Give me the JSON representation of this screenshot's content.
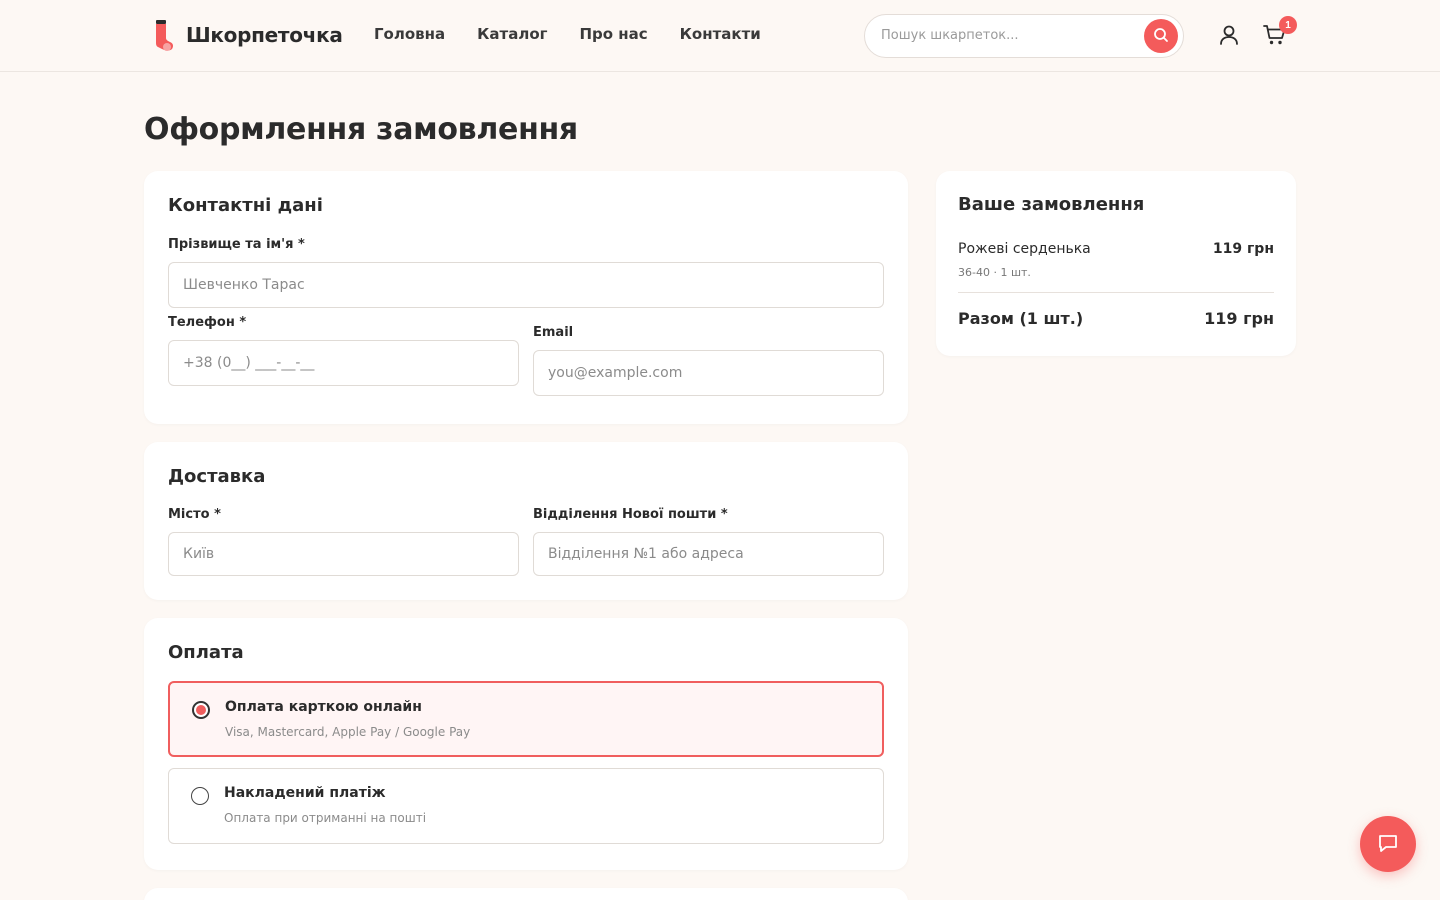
{
  "brand": {
    "name": "Шкорпеточка",
    "accent": "#f45b5b"
  },
  "nav": [
    "Головна",
    "Каталог",
    "Про нас",
    "Контакти"
  ],
  "search": {
    "placeholder": "Пошук шкарпеток..."
  },
  "cart": {
    "count": "1"
  },
  "page": {
    "title": "Оформлення замовлення"
  },
  "contact": {
    "title": "Контактні дані",
    "name_label": "Прізвище та ім'я *",
    "name_placeholder": "Шевченко Тарас",
    "phone_label": "Телефон *",
    "phone_placeholder": "+38 (0__) ___-__-__",
    "email_label": "Email",
    "email_placeholder": "you@example.com"
  },
  "delivery": {
    "title": "Доставка",
    "city_label": "Місто *",
    "city_placeholder": "Київ",
    "branch_label": "Відділення Нової пошти *",
    "branch_placeholder": "Відділення №1 або адреса"
  },
  "payment": {
    "title": "Оплата",
    "options": [
      {
        "title": "Оплата карткою онлайн",
        "subtitle": "Visa, Mastercard, Apple Pay / Google Pay",
        "selected": true
      },
      {
        "title": "Накладений платіж",
        "subtitle": "Оплата при отриманні на пошті",
        "selected": false
      }
    ]
  },
  "summary": {
    "title": "Ваше замовлення",
    "item_name": "Рожеві серденька",
    "item_price": "119 грн",
    "item_meta": "36-40 · 1 шт.",
    "total_label": "Разом (1 шт.)",
    "total_value": "119 грн"
  }
}
